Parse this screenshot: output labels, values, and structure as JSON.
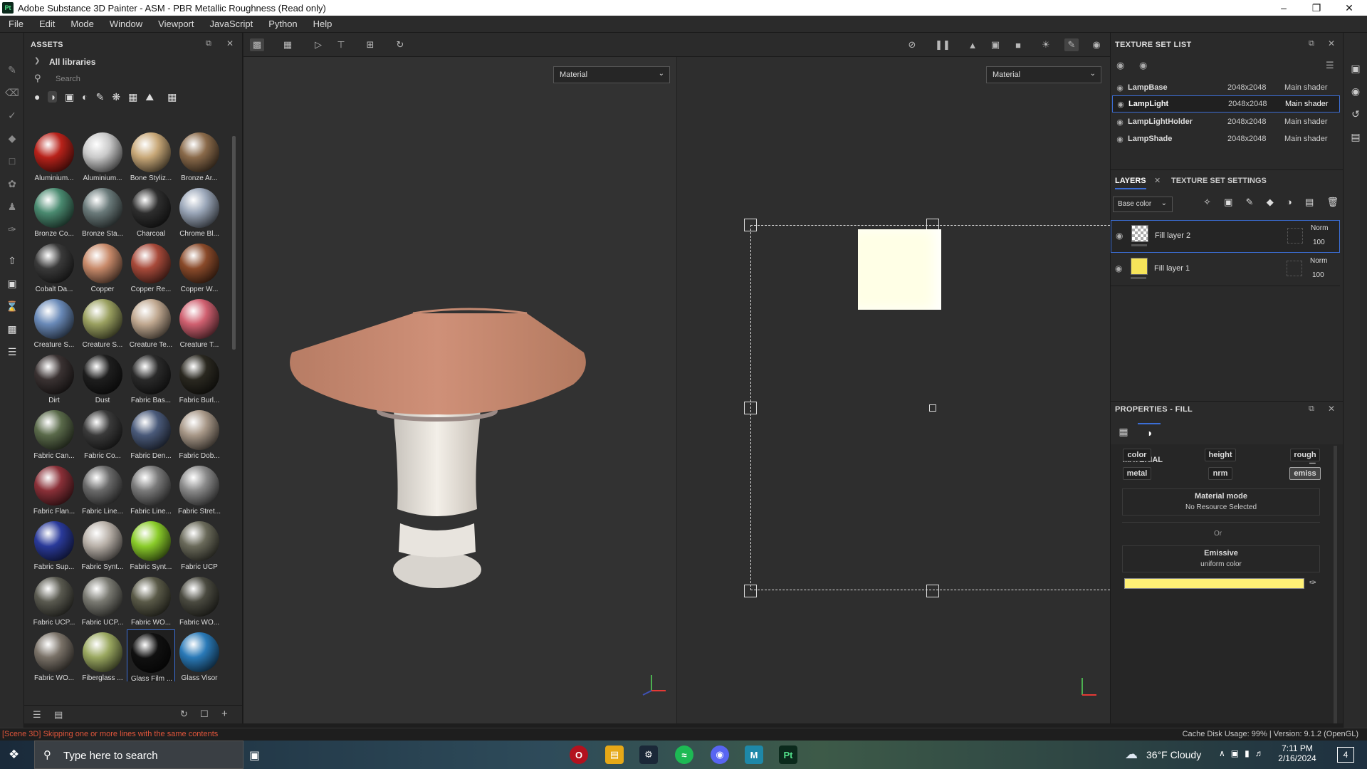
{
  "window": {
    "title": "Adobe Substance 3D Painter - ASM - PBR Metallic Roughness (Read only)",
    "app_icon": "Pt"
  },
  "menu": [
    "File",
    "Edit",
    "Mode",
    "Window",
    "Viewport",
    "JavaScript",
    "Python",
    "Help"
  ],
  "assets": {
    "title": "ASSETS",
    "breadcrumb": "All libraries",
    "search_placeholder": "Search",
    "items": [
      {
        "label": "Aluminium...",
        "color": "#b8221a"
      },
      {
        "label": "Aluminium...",
        "color": "#c9c9c9"
      },
      {
        "label": "Bone Styliz...",
        "color": "#c8a878"
      },
      {
        "label": "Bronze Ar...",
        "color": "#8a6a4a"
      },
      {
        "label": "Bronze Co...",
        "color": "#4a8a70"
      },
      {
        "label": "Bronze Sta...",
        "color": "#6a7a7a"
      },
      {
        "label": "Charcoal",
        "color": "#2e2e2e"
      },
      {
        "label": "Chrome Bl...",
        "color": "#9aa6b8"
      },
      {
        "label": "Cobalt Da...",
        "color": "#3a3a3a"
      },
      {
        "label": "Copper",
        "color": "#c88a6a"
      },
      {
        "label": "Copper Re...",
        "color": "#a84a3a"
      },
      {
        "label": "Copper W...",
        "color": "#8a4a2a"
      },
      {
        "label": "Creature S...",
        "color": "#6a8ab8"
      },
      {
        "label": "Creature S...",
        "color": "#9aa060"
      },
      {
        "label": "Creature Te...",
        "color": "#c0a890"
      },
      {
        "label": "Creature T...",
        "color": "#d06070"
      },
      {
        "label": "Dirt",
        "color": "#3a3232"
      },
      {
        "label": "Dust",
        "color": "#1e1e1e"
      },
      {
        "label": "Fabric Bas...",
        "color": "#2a2a2a"
      },
      {
        "label": "Fabric Burl...",
        "color": "#2a2820"
      },
      {
        "label": "Fabric Can...",
        "color": "#5a6a4a"
      },
      {
        "label": "Fabric Co...",
        "color": "#3a3a3a"
      },
      {
        "label": "Fabric Den...",
        "color": "#4a5a7a"
      },
      {
        "label": "Fabric Dob...",
        "color": "#a89888"
      },
      {
        "label": "Fabric Flan...",
        "color": "#8a3038"
      },
      {
        "label": "Fabric Line...",
        "color": "#6a6a6a"
      },
      {
        "label": "Fabric Line...",
        "color": "#7a7a7a"
      },
      {
        "label": "Fabric Stret...",
        "color": "#8a8a8a"
      },
      {
        "label": "Fabric Sup...",
        "color": "#2a3a9a"
      },
      {
        "label": "Fabric Synt...",
        "color": "#b8b0a8"
      },
      {
        "label": "Fabric Synt...",
        "color": "#8acc2a"
      },
      {
        "label": "Fabric UCP",
        "color": "#6a6a5a"
      },
      {
        "label": "Fabric UCP...",
        "color": "#5a5a50"
      },
      {
        "label": "Fabric UCP...",
        "color": "#7a7a72"
      },
      {
        "label": "Fabric WO...",
        "color": "#5a5a48"
      },
      {
        "label": "Fabric WO...",
        "color": "#4a4a40"
      },
      {
        "label": "Fabric WO...",
        "color": "#7a7268"
      },
      {
        "label": "Fiberglass ...",
        "color": "#9aa860"
      },
      {
        "label": "Glass Film ...",
        "color": "#101010"
      },
      {
        "label": "Glass Visor",
        "color": "#2a7ab8"
      },
      {
        "label": "",
        "color": "#c8a020"
      },
      {
        "label": "",
        "color": "#c8a868"
      },
      {
        "label": "",
        "color": "#3a8ab8"
      },
      {
        "label": "",
        "color": "#9a9a9a"
      }
    ]
  },
  "viewport": {
    "left_mode": "Material",
    "right_mode": "Material"
  },
  "texture_set_list": {
    "title": "TEXTURE SET LIST",
    "rows": [
      {
        "name": "LampBase",
        "size": "2048x2048",
        "shader": "Main shader"
      },
      {
        "name": "LampLight",
        "size": "2048x2048",
        "shader": "Main shader"
      },
      {
        "name": "LampLightHolder",
        "size": "2048x2048",
        "shader": "Main shader"
      },
      {
        "name": "LampShade",
        "size": "2048x2048",
        "shader": "Main shader"
      }
    ]
  },
  "layers": {
    "tab_layers": "LAYERS",
    "tab_settings": "TEXTURE SET SETTINGS",
    "channel": "Base color",
    "items": [
      {
        "name": "Fill layer 2",
        "blend": "Norm",
        "opacity": "100"
      },
      {
        "name": "Fill layer 1",
        "blend": "Norm",
        "opacity": "100"
      }
    ]
  },
  "properties": {
    "title": "PROPERTIES - FILL",
    "section": "MATERIAL",
    "channels": [
      "color",
      "height",
      "rough",
      "metal",
      "nrm",
      "emiss"
    ],
    "material_mode_label": "Material mode",
    "material_mode_value": "No Resource Selected",
    "or_label": "Or",
    "emissive_label": "Emissive",
    "emissive_value": "uniform color",
    "emissive_color": "#fff176"
  },
  "status": {
    "message": "[Scene 3D] Skipping one or more lines with the same contents",
    "right": "Cache Disk Usage:   99% | Version: 9.1.2 (OpenGL)"
  },
  "taskbar": {
    "search_placeholder": "Type here to search",
    "weather": "36°F  Cloudy",
    "time": "7:11 PM",
    "date": "2/16/2024",
    "notifications": "4"
  }
}
